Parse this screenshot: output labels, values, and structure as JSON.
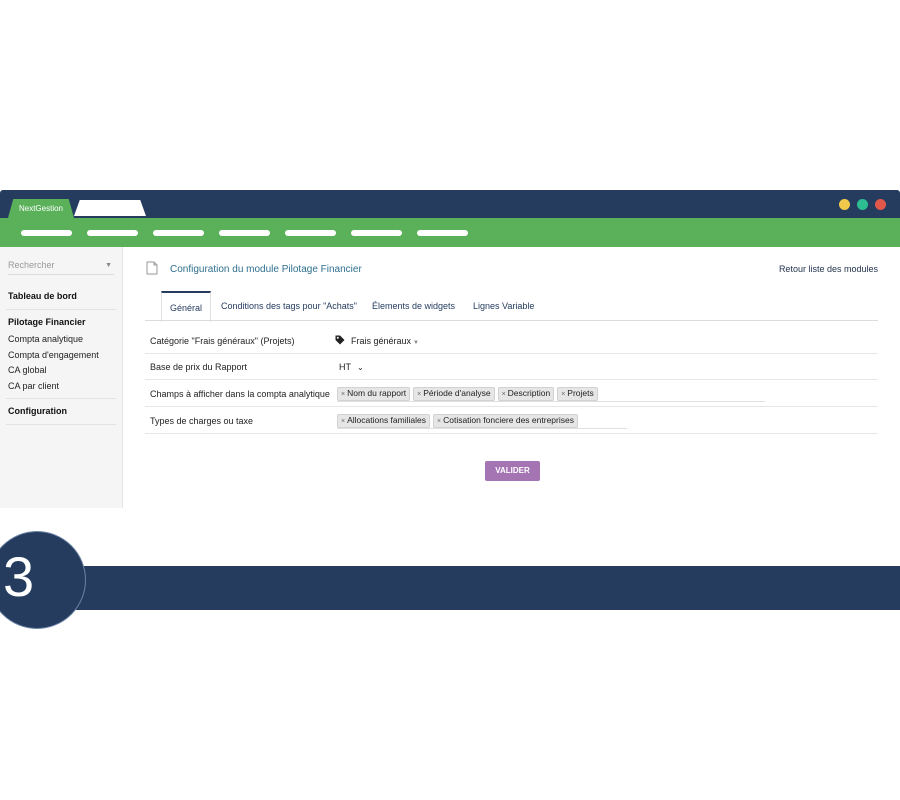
{
  "app": {
    "tab_active": "NextGestion"
  },
  "window_controls": {
    "colors": [
      "#f0c94b",
      "#2dbd92",
      "#e2574c"
    ]
  },
  "colors": {
    "navy": "#253c5f",
    "green": "#5bb15a",
    "purple": "#a474b3",
    "link": "#2e6f8e"
  },
  "sidebar": {
    "search_placeholder": "Rechercher",
    "sections": [
      {
        "title": "Tableau de bord",
        "items": []
      },
      {
        "title": "Pilotage Financier",
        "items": [
          "Compta analytique",
          "Compta d'engagement",
          "CA global",
          "CA par client"
        ]
      },
      {
        "title": "Configuration",
        "items": []
      }
    ]
  },
  "main": {
    "title": "Configuration du module Pilotage Financier",
    "back_link": "Retour liste des modules",
    "tabs": [
      "Général",
      "Conditions des tags pour \"Achats\"",
      "Élements de widgets",
      "Lignes Variable"
    ],
    "rows": {
      "category": {
        "label": "Catégorie \"Frais généraux\" (Projets)",
        "value": "Frais généraux"
      },
      "base_price": {
        "label": "Base de prix du Rapport",
        "value": "HT"
      },
      "fields": {
        "label": "Champs à afficher dans la compta analytique",
        "chips": [
          "Nom du rapport",
          "Période d'analyse",
          "Description",
          "Projets"
        ]
      },
      "charges": {
        "label": "Types de charges ou taxe",
        "chips": [
          "Allocations familiales",
          "Cotisation fonciere des entreprises"
        ]
      }
    },
    "submit_label": "VALIDER"
  },
  "step": {
    "number": "3"
  }
}
